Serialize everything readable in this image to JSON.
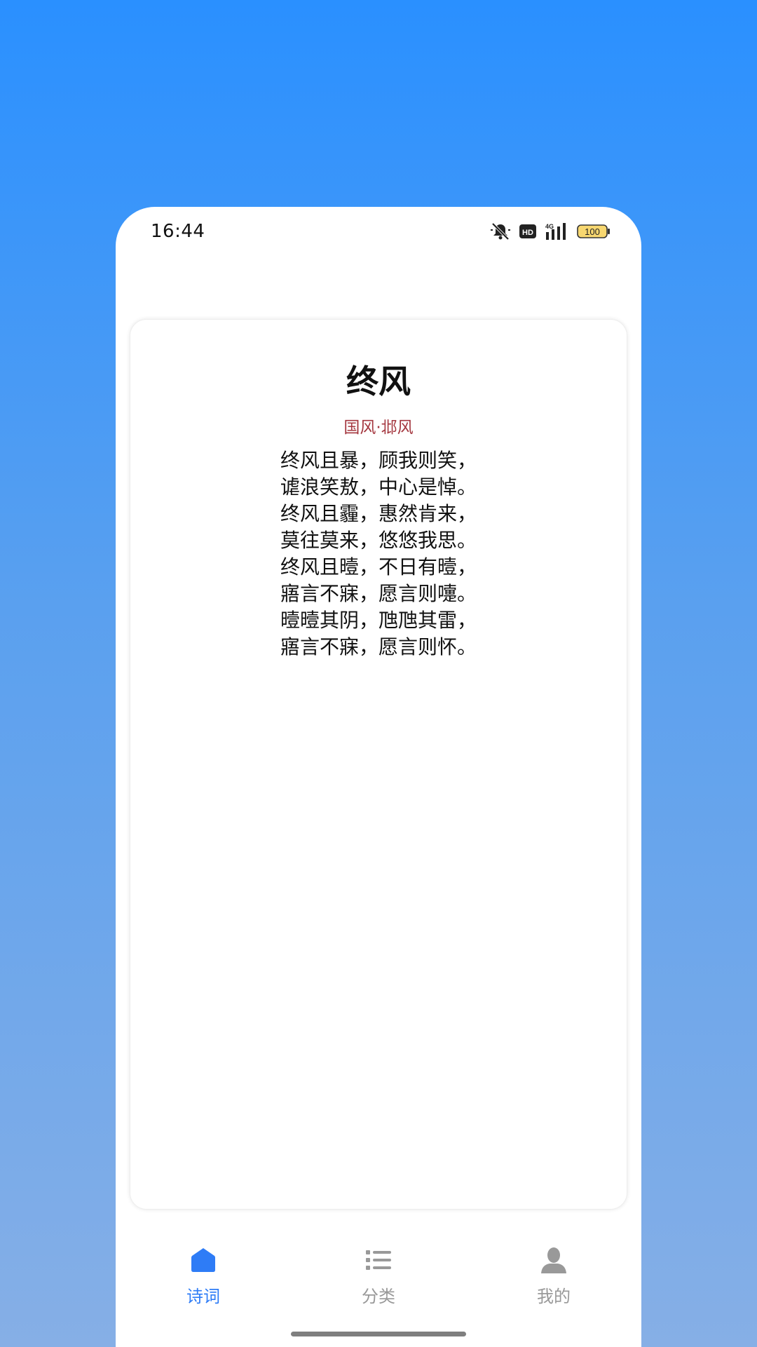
{
  "status_bar": {
    "time": "16:44",
    "battery": "100",
    "network": "4G",
    "icons": [
      "bell-muted-icon",
      "hd-icon",
      "signal-4g-icon",
      "battery-icon"
    ]
  },
  "poem": {
    "title": "终风",
    "source": "国风·邶风",
    "lines": [
      "终风且暴，顾我则笑，",
      "谑浪笑敖，中心是悼。",
      "终风且霾，惠然肯来，",
      "莫往莫来，悠悠我思。",
      "终风且曀，不日有曀，",
      "寤言不寐，愿言则嚏。",
      "曀曀其阴，虺虺其雷，",
      "寤言不寐，愿言则怀。"
    ]
  },
  "tabbar": {
    "active": "poems",
    "active_color": "#2e7cf6",
    "inactive_color": "#999999",
    "tabs": [
      {
        "id": "poems",
        "label": "诗词",
        "icon": "home-icon"
      },
      {
        "id": "categories",
        "label": "分类",
        "icon": "list-icon"
      },
      {
        "id": "mine",
        "label": "我的",
        "icon": "person-icon"
      }
    ]
  }
}
